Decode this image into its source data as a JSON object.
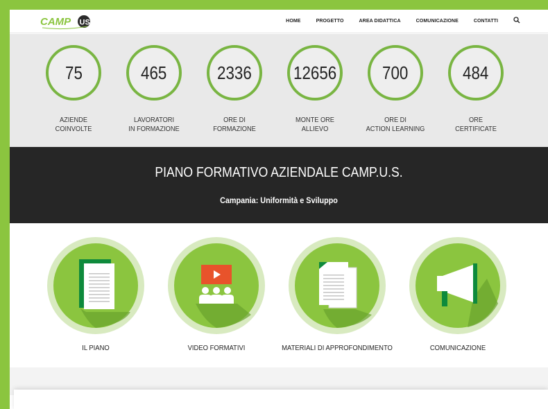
{
  "header": {
    "logo_text": "CAMPUS",
    "nav": [
      {
        "label": "HOME",
        "name": "nav-home"
      },
      {
        "label": "PROGETTO",
        "name": "nav-progetto"
      },
      {
        "label": "AREA DIDATTICA",
        "name": "nav-area-didattica"
      },
      {
        "label": "COMUNICAZIONE",
        "name": "nav-comunicazione"
      },
      {
        "label": "CONTATTI",
        "name": "nav-contatti"
      }
    ],
    "search_icon": "search-icon"
  },
  "stats": [
    {
      "value": "75",
      "label": "AZIENDE\nCOINVOLTE"
    },
    {
      "value": "465",
      "label": "LAVORATORI\nIN FORMAZIONE"
    },
    {
      "value": "2336",
      "label": "ORE DI\nFORMAZIONE"
    },
    {
      "value": "12656",
      "label": "MONTE ORE\nALLIEVO"
    },
    {
      "value": "700",
      "label": "ORE DI\nACTION LEARNING"
    },
    {
      "value": "484",
      "label": "ORE\nCERTIFICATE"
    }
  ],
  "band": {
    "title": "PIANO FORMATIVO AZIENDALE CAMP.U.S.",
    "subtitle": "Campania: Uniformità e Sviluppo"
  },
  "features": [
    {
      "label": "IL PIANO",
      "icon": "document-icon"
    },
    {
      "label": "VIDEO FORMATIVI",
      "icon": "video-audience-icon"
    },
    {
      "label": "MATERIALI DI APPROFONDIMENTO",
      "icon": "documents-stack-icon"
    },
    {
      "label": "COMUNICAZIONE",
      "icon": "megaphone-icon"
    }
  ],
  "colors": {
    "accent_green": "#8bc53f",
    "circle_green": "#79b542",
    "dark_band": "#262626",
    "stats_bg": "#e9e9e9",
    "video_red": "#e8532b"
  }
}
